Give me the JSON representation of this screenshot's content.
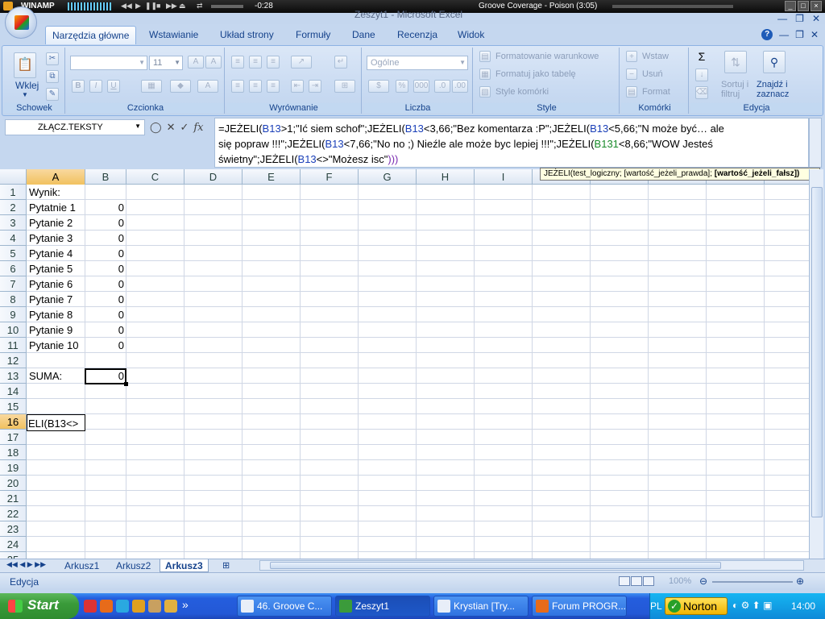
{
  "winamp": {
    "title": "WINAMP",
    "time": "-0:28",
    "song": "Groove Coverage - Poison (3:05)"
  },
  "window": {
    "title": "Zeszyt1 - Microsoft Excel"
  },
  "ribbon": {
    "tabs": [
      "Narzędzia główne",
      "Wstawianie",
      "Układ strony",
      "Formuły",
      "Dane",
      "Recenzja",
      "Widok"
    ],
    "active_tab": "Narzędzia główne",
    "groups": {
      "clipboard": {
        "label": "Schowek",
        "paste": "Wklej"
      },
      "font": {
        "label": "Czcionka",
        "size": "11"
      },
      "alignment": {
        "label": "Wyrównanie"
      },
      "number": {
        "label": "Liczba",
        "format": "Ogólne"
      },
      "styles": {
        "label": "Style",
        "conditional": "Formatowanie warunkowe",
        "as_table": "Formatuj jako tabelę",
        "cell_styles": "Style komórki"
      },
      "cells": {
        "label": "Komórki",
        "insert": "Wstaw",
        "delete": "Usuń",
        "format": "Format"
      },
      "editing": {
        "label": "Edycja",
        "sort": "Sortuj i filtruj",
        "find": "Znajdź i zaznacz"
      }
    }
  },
  "formula_bar": {
    "name_box": "ZŁĄCZ.TEKSTY",
    "fx": "fx",
    "line1": [
      "=JEŻELI(",
      "B13",
      ">1;\"Ić siem schof\";JEŻELI(",
      "B13",
      "<3,66;\"Bez komentarza :P\";JEŻELI(",
      "B13",
      "<5,66;\"N może być… ale"
    ],
    "line2": [
      "się popraw !!!\";JEŻELI(",
      "B13",
      "<7,66;\"No no ;) Nieźle ale może byc lepiej !!!\";JEŻELI(",
      "B131",
      "<8,66;\"WOW Jesteś"
    ],
    "line3": [
      "świetny\";JEŻELI(",
      "B13",
      "<>\"Możesz isc\"",
      ")))"
    ],
    "tooltip_fn": "JEŻELI(test_logiczny; [wartość_jeżeli_prawda]; ",
    "tooltip_bold": "[wartość_jeżeli_fałsz])"
  },
  "grid": {
    "columns": [
      "A",
      "B",
      "C",
      "D",
      "E",
      "F",
      "G",
      "H",
      "I"
    ],
    "rows": [
      "1",
      "2",
      "3",
      "4",
      "5",
      "6",
      "7",
      "8",
      "9",
      "10",
      "11",
      "12",
      "13",
      "14",
      "15",
      "16",
      "17",
      "18",
      "19",
      "20",
      "21",
      "22",
      "23",
      "24",
      "25"
    ],
    "cells": [
      {
        "row": 1,
        "a": "Wynik:",
        "b": ""
      },
      {
        "row": 2,
        "a": "Pytatnie 1",
        "b": "0"
      },
      {
        "row": 3,
        "a": "Pytanie 2",
        "b": "0"
      },
      {
        "row": 4,
        "a": "Pytanie 3",
        "b": "0"
      },
      {
        "row": 5,
        "a": "Pytanie 4",
        "b": "0"
      },
      {
        "row": 6,
        "a": "Pytanie 5",
        "b": "0"
      },
      {
        "row": 7,
        "a": "Pytanie 6",
        "b": "0"
      },
      {
        "row": 8,
        "a": "Pytanie 7",
        "b": "0"
      },
      {
        "row": 9,
        "a": "Pytanie 8",
        "b": "0"
      },
      {
        "row": 10,
        "a": "Pytanie 9",
        "b": "0"
      },
      {
        "row": 11,
        "a": "Pytanie 10",
        "b": "0"
      },
      {
        "row": 13,
        "a": "SUMA:",
        "b": "0"
      }
    ],
    "editing_cell_text": "ELI(B13<>"
  },
  "sheets": {
    "tabs": [
      "Arkusz1",
      "Arkusz2",
      "Arkusz3"
    ],
    "active": "Arkusz3"
  },
  "status": {
    "mode": "Edycja",
    "zoom": "100%"
  },
  "taskbar": {
    "start": "Start",
    "tasks": [
      "46. Groove C...",
      "Zeszyt1",
      "Krystian [Try...",
      "Forum PROGR..."
    ],
    "active_task": "Zeszyt1",
    "lang": "PL",
    "norton": "Norton",
    "clock": "14:00"
  }
}
